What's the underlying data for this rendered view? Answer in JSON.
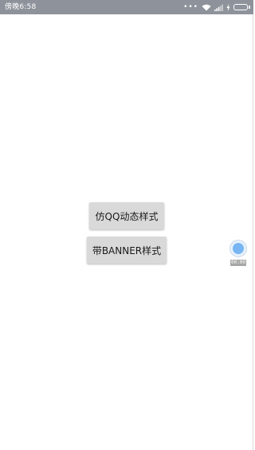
{
  "status_bar": {
    "time": "傍晚6:58",
    "icons": [
      "more-dots-icon",
      "wifi-icon",
      "signal-icon",
      "charging-icon",
      "battery-icon"
    ],
    "more_dots": "•••",
    "battery_color": "#3fd23f",
    "background_color": "#8e939b"
  },
  "main": {
    "buttons": [
      {
        "label": "仿QQ动态样式"
      },
      {
        "label": "带BANNER样式"
      }
    ]
  },
  "floating_widget": {
    "icon": "record-circle-icon",
    "timer": "00:00",
    "accent_color": "#78b6f3"
  }
}
